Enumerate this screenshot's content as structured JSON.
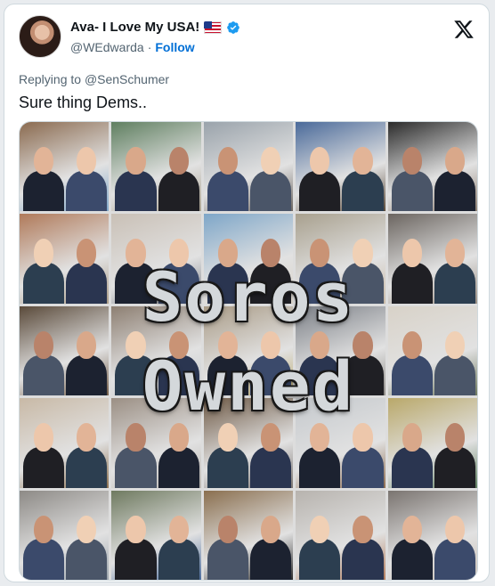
{
  "post": {
    "author_name": "Ava- I Love My USA!",
    "handle": "@WEdwarda",
    "separator": "·",
    "follow_label": "Follow",
    "replying_prefix": "Replying to ",
    "replying_to": "@SenSchumer",
    "text": "Sure thing Dems.."
  },
  "media": {
    "overlay_line1": "Soros",
    "overlay_line2": "Owned",
    "grid_rows": 5,
    "grid_cols": 5
  },
  "icons": {
    "flag": "us-flag-icon",
    "verified": "verified-badge-icon",
    "logo": "x-logo-icon"
  },
  "colors": {
    "text": "#0f1419",
    "muted": "#536471",
    "link": "#006fd6",
    "verified": "#1d9bf0"
  }
}
